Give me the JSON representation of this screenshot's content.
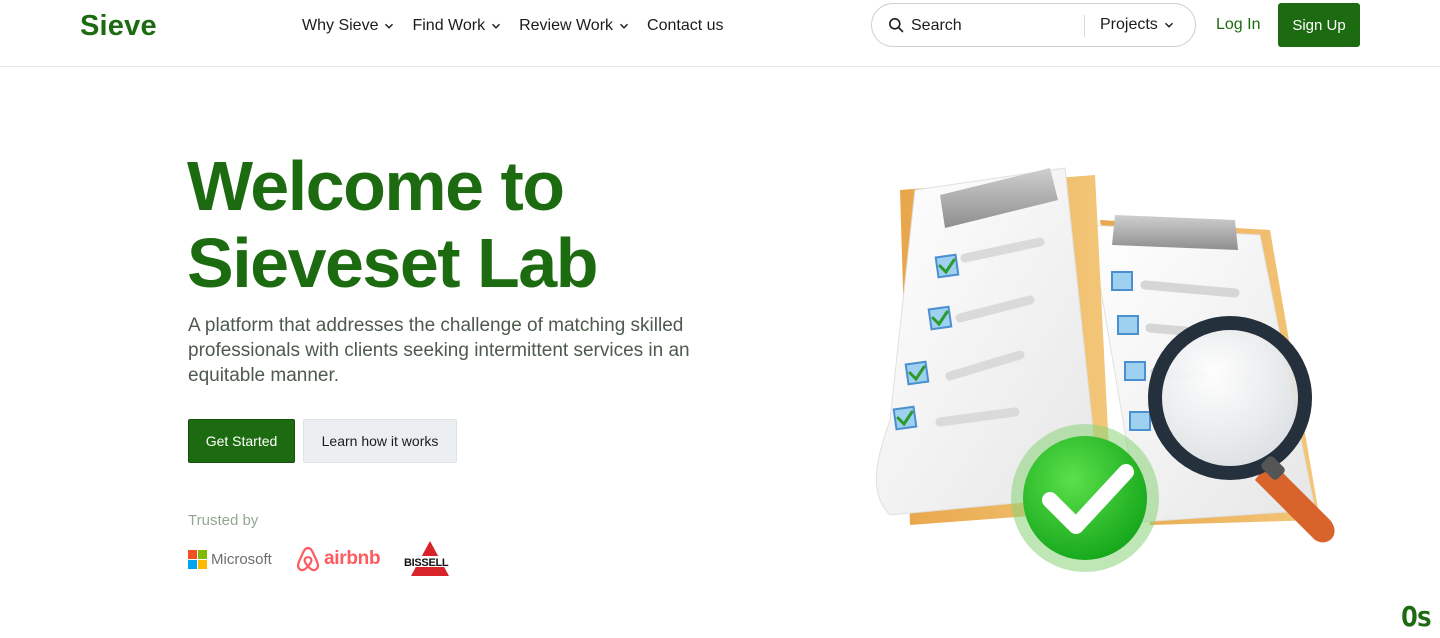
{
  "header": {
    "logo": "Sieve",
    "nav": [
      {
        "label": "Why Sieve",
        "has_dropdown": true
      },
      {
        "label": "Find Work",
        "has_dropdown": true
      },
      {
        "label": "Review Work",
        "has_dropdown": true
      },
      {
        "label": "Contact us",
        "has_dropdown": false
      }
    ],
    "search": {
      "placeholder": "Search",
      "scope": "Projects"
    },
    "login": "Log In",
    "signup": "Sign Up"
  },
  "hero": {
    "title_line1": "Welcome to",
    "title_line2": "Sieveset Lab",
    "description": "A platform that addresses the challenge of matching skilled professionals with clients seeking intermittent services in an equitable manner.",
    "primary_button": "Get Started",
    "secondary_button": "Learn how it works"
  },
  "trusted": {
    "label": "Trusted by",
    "brands": [
      "Microsoft",
      "airbnb",
      "BISSELL"
    ]
  },
  "watermark": "Os",
  "colors": {
    "brand_green": "#1d6b10",
    "secondary_button_bg": "#eceff1",
    "airbnb_red": "#ff5a5f"
  },
  "icons": [
    "search-icon",
    "chevron-down-icon",
    "checklist-clipboard-illustration",
    "magnifying-glass-illustration",
    "check-badge-illustration"
  ]
}
